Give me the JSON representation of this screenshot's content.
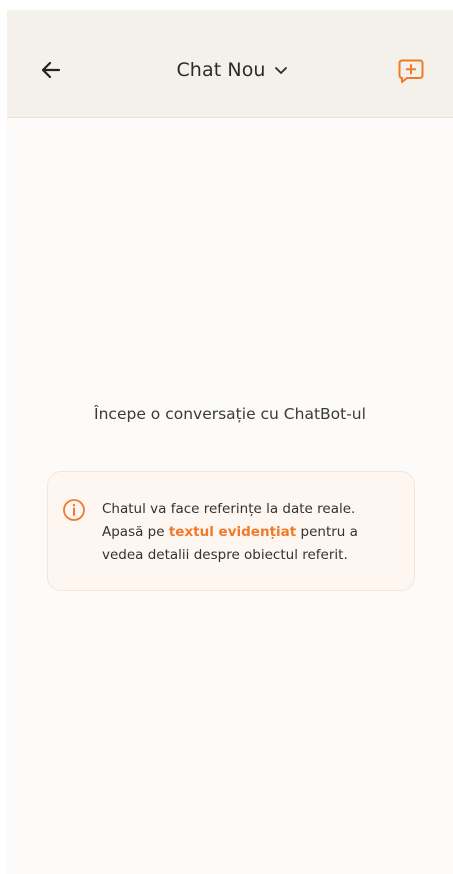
{
  "header": {
    "title": "Chat Nou"
  },
  "empty_state": {
    "title": "Începe o conversație cu ChatBot-ul"
  },
  "info": {
    "line1": "Chatul va face referințe la date reale.",
    "line2_before": "Apasă pe ",
    "line2_highlight": "textul evidențiat",
    "line2_after": " pentru a",
    "line3": "vedea detalii despre obiectul referit."
  },
  "colors": {
    "accent": "#f07a2a",
    "header_bg": "#f4f0ea",
    "background": "#fcfbf9",
    "card_bg": "#fdf6f1"
  },
  "icons": {
    "back": "arrow-left-icon",
    "dropdown": "chevron-down-icon",
    "new_chat": "chat-plus-icon",
    "info": "info-circle-icon"
  }
}
